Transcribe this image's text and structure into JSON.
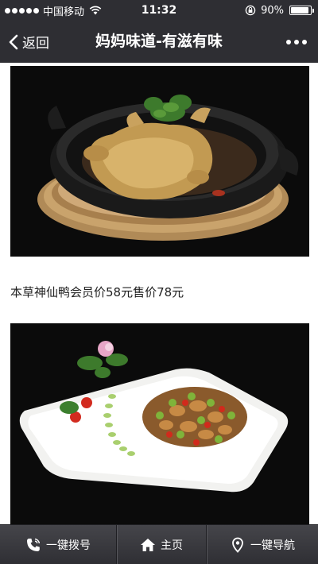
{
  "status_bar": {
    "carrier": "中国移动",
    "time": "11:32",
    "battery_percent": "90%",
    "battery_level": 0.9,
    "signal_dots": 5
  },
  "nav": {
    "back_label": "返回",
    "title": "妈妈味道-有滋有味",
    "more_icon": "more-dots-icon"
  },
  "content": {
    "items": [
      {
        "image": "duck-in-clay-pot-photo"
      },
      {
        "caption": "本草神仙鸭会员价58元售价78元"
      },
      {
        "image": "stir-fried-dish-on-white-plate-photo"
      }
    ]
  },
  "toolbar": {
    "call_label": "一键拨号",
    "call_icon": "phone-icon",
    "home_label": "主页",
    "home_icon": "home-icon",
    "nav_label": "一键导航",
    "nav_icon": "location-pin-icon"
  },
  "colors": {
    "bar_background": "#2e2e33",
    "text_on_bar": "#ffffff",
    "photo_background": "#0b0b0b",
    "caption_text": "#222222"
  }
}
